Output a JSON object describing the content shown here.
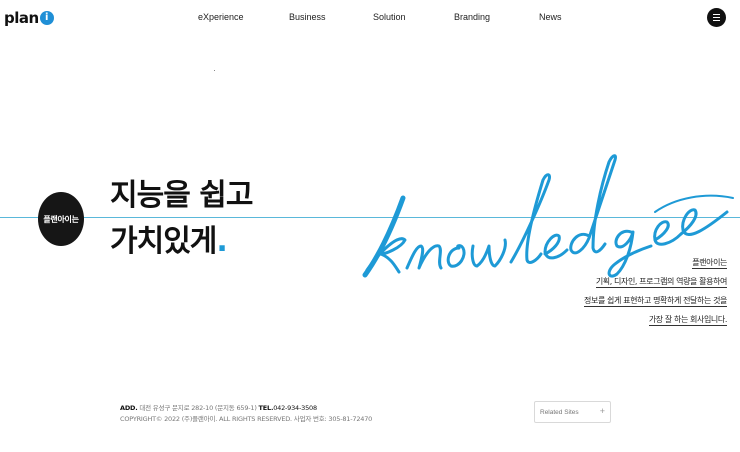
{
  "brand": {
    "name": "plan",
    "mark": "i"
  },
  "nav": [
    "eXperience",
    "Business",
    "Solution",
    "Branding",
    "News"
  ],
  "menu": {
    "icon": "hamburger-icon"
  },
  "badge": {
    "label": "플랜아이는"
  },
  "headline": {
    "line1": "지능을 쉽고",
    "line2": "가치있게",
    "accent": ".",
    "accent_color": "#1e9ad6"
  },
  "script_word": "knowledge",
  "script_color": "#1e9ad6",
  "description": [
    "플랜아이는",
    "기획, 디자인, 프로그램의 역량을 활용하여",
    "정보를 쉽게 표현하고 명확하게 전달하는 것을",
    "가장 잘 하는 회사입니다."
  ],
  "footer": {
    "add_label": "ADD.",
    "address": "대전 유성구 문지로 282-10 (문지동 659-1)",
    "tel_label": "TEL.",
    "tel": "042-934-3508",
    "copyright": "COPYRIGHT© 2022 (주)플랜아이. ALL RIGHTS RESERVED. 사업자 번호: 305-81-72470"
  },
  "related": {
    "label": "Related Sites",
    "icon": "plus-icon"
  },
  "colors": {
    "line": "#5ab8da",
    "badge_bg": "#161616"
  }
}
